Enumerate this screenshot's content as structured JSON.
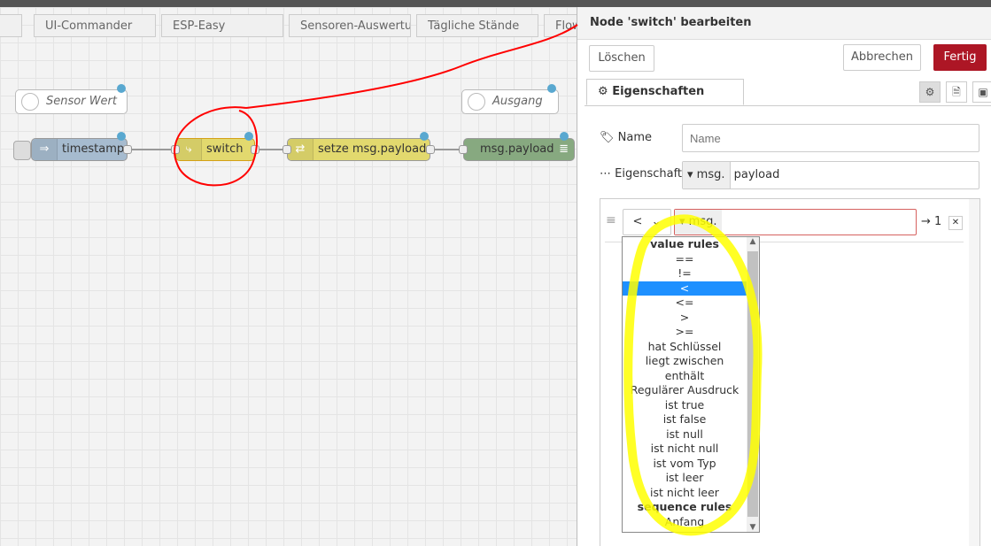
{
  "tabs": [
    "UI-Commander",
    "ESP-Easy",
    "Sensoren-Auswertung",
    "Tägliche Stände",
    "Flow"
  ],
  "nodes": {
    "sensor_wert": "Sensor Wert",
    "ausgang": "Ausgang",
    "timestamp": "timestamp",
    "switch": "switch",
    "setze": "setze msg.payload",
    "debug": "msg.payload"
  },
  "colors": {
    "inject": "#a6bbcf",
    "switch": "#e2d96e",
    "change": "#e2d96e",
    "debug": "#87a980",
    "primary": "#ad1625",
    "highlight": "#ffff00",
    "annotation": "#ff0000"
  },
  "editor": {
    "title": "Node 'switch' bearbeiten",
    "delete": "Löschen",
    "cancel": "Abbrechen",
    "done": "Fertig",
    "tab": "Eigenschaften",
    "name_label": "Name",
    "name_placeholder": "Name",
    "property_label": "Eigenschaft",
    "property_prefix": "msg.",
    "property_value": "payload",
    "rule_operator": "<",
    "rule_value_prefix": "msg.",
    "rule_output": "→ 1"
  },
  "dropdown": [
    {
      "label": "value rules",
      "group": true
    },
    {
      "label": "=="
    },
    {
      "label": "!="
    },
    {
      "label": "<",
      "selected": true
    },
    {
      "label": "<="
    },
    {
      "label": ">"
    },
    {
      "label": ">="
    },
    {
      "label": "hat Schlüssel"
    },
    {
      "label": "liegt zwischen"
    },
    {
      "label": "enthält"
    },
    {
      "label": "Regulärer Ausdruck"
    },
    {
      "label": "ist true"
    },
    {
      "label": "ist false"
    },
    {
      "label": "ist null"
    },
    {
      "label": "ist nicht null"
    },
    {
      "label": "ist vom Typ"
    },
    {
      "label": "ist leer"
    },
    {
      "label": "ist nicht leer"
    },
    {
      "label": "sequence rules",
      "group": true
    },
    {
      "label": "Anfang"
    }
  ]
}
